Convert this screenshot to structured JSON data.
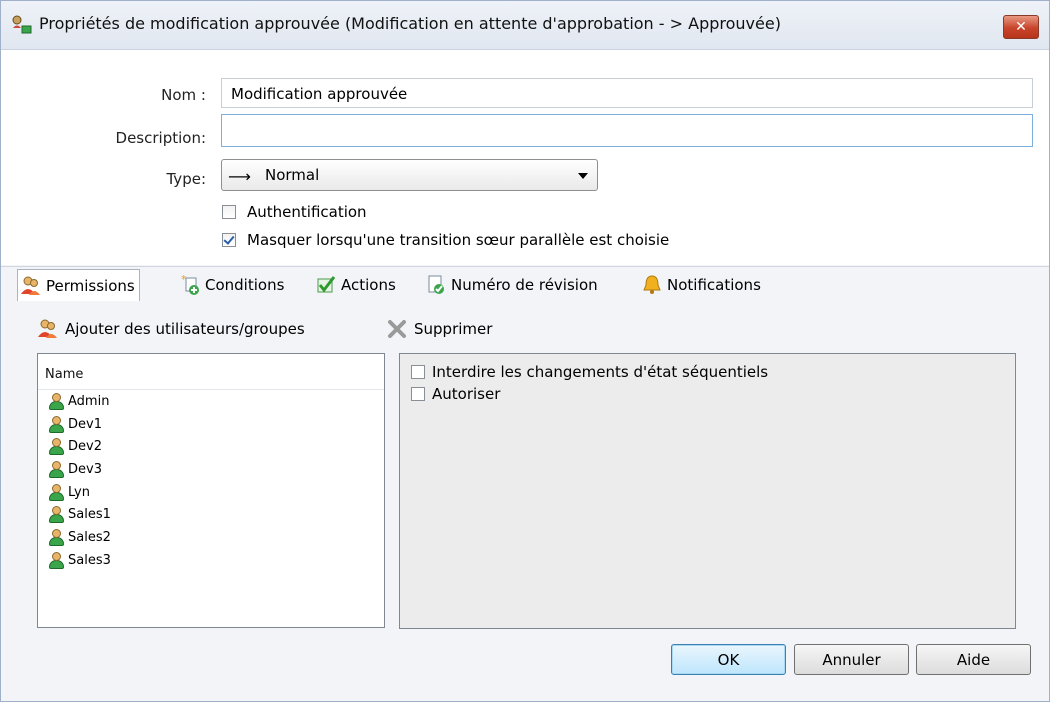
{
  "window": {
    "title": "Propriétés de modification approuvée (Modification en attente d'approbation - > Approuvée)",
    "close_label": "✕"
  },
  "form": {
    "name_label": "Nom :",
    "name_value": "Modification approuvée",
    "description_label": "Description:",
    "description_value": "",
    "type_label": "Type:",
    "type_value": "Normal",
    "auth_label": "Authentification",
    "auth_checked": false,
    "hide_label": "Masquer lorsqu'une transition sœur parallèle est choisie",
    "hide_checked": true
  },
  "tabs": [
    {
      "label": "Permissions",
      "icon": "users-icon",
      "active": true
    },
    {
      "label": "Conditions",
      "icon": "conditions-icon",
      "active": false
    },
    {
      "label": "Actions",
      "icon": "check-icon",
      "active": false
    },
    {
      "label": "Numéro de révision",
      "icon": "revision-icon",
      "active": false
    },
    {
      "label": "Notifications",
      "icon": "bell-icon",
      "active": false
    }
  ],
  "toolbar": {
    "add_label": "Ajouter des utilisateurs/groupes",
    "delete_label": "Supprimer"
  },
  "users": {
    "header": "Name",
    "items": [
      "Admin",
      "Dev1",
      "Dev2",
      "Dev3",
      "Lyn",
      "Sales1",
      "Sales2",
      "Sales3"
    ]
  },
  "permissions": [
    {
      "label": "Interdire les changements d'état séquentiels",
      "checked": false
    },
    {
      "label": "Autoriser",
      "checked": false
    }
  ],
  "buttons": {
    "ok": "OK",
    "cancel": "Annuler",
    "help": "Aide"
  }
}
